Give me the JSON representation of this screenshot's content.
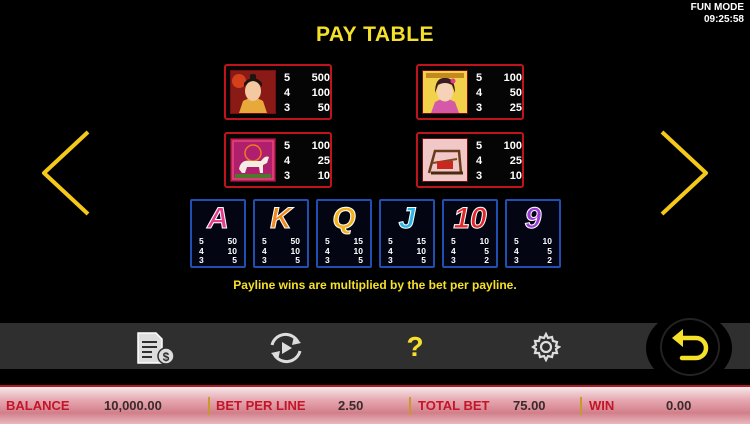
{
  "status": {
    "mode": "FUN MODE",
    "time": "09:25:58"
  },
  "title": "PAY TABLE",
  "symbols_top": [
    {
      "name": "warrior",
      "rows": [
        [
          "5",
          "500"
        ],
        [
          "4",
          "100"
        ],
        [
          "3",
          "50"
        ]
      ]
    },
    {
      "name": "lady",
      "rows": [
        [
          "5",
          "100"
        ],
        [
          "4",
          "50"
        ],
        [
          "3",
          "25"
        ]
      ]
    },
    {
      "name": "horse",
      "rows": [
        [
          "5",
          "100"
        ],
        [
          "4",
          "25"
        ],
        [
          "3",
          "10"
        ]
      ]
    },
    {
      "name": "loom",
      "rows": [
        [
          "5",
          "100"
        ],
        [
          "4",
          "25"
        ],
        [
          "3",
          "10"
        ]
      ]
    }
  ],
  "symbols_low": [
    {
      "letter": "A",
      "color": "#e23c8c",
      "rows": [
        [
          "5",
          "50"
        ],
        [
          "4",
          "10"
        ],
        [
          "3",
          "5"
        ]
      ]
    },
    {
      "letter": "K",
      "color": "#f08a1c",
      "rows": [
        [
          "5",
          "50"
        ],
        [
          "4",
          "10"
        ],
        [
          "3",
          "5"
        ]
      ]
    },
    {
      "letter": "Q",
      "color": "#f2b21b",
      "rows": [
        [
          "5",
          "15"
        ],
        [
          "4",
          "10"
        ],
        [
          "3",
          "5"
        ]
      ]
    },
    {
      "letter": "J",
      "color": "#2bb6e6",
      "rows": [
        [
          "5",
          "15"
        ],
        [
          "4",
          "10"
        ],
        [
          "3",
          "5"
        ]
      ]
    },
    {
      "letter": "10",
      "color": "#e2262a",
      "rows": [
        [
          "5",
          "10"
        ],
        [
          "4",
          "5"
        ],
        [
          "3",
          "2"
        ]
      ]
    },
    {
      "letter": "9",
      "color": "#9c3ad6",
      "rows": [
        [
          "5",
          "10"
        ],
        [
          "4",
          "5"
        ],
        [
          "3",
          "2"
        ]
      ]
    }
  ],
  "note": "Payline wins are multiplied by the bet per payline.",
  "toolbar": {
    "icons": [
      "paytable-icon",
      "autoplay-icon",
      "help-icon",
      "settings-icon"
    ],
    "help_glyph": "?",
    "spin_icon": "return-arrow-icon"
  },
  "footer": {
    "balance_label": "BALANCE",
    "balance_value": "10,000.00",
    "bet_label": "BET PER LINE",
    "bet_value": "2.50",
    "total_label": "TOTAL BET",
    "total_value": "75.00",
    "win_label": "WIN",
    "win_value": "0.00"
  },
  "colors": {
    "accent_yellow": "#f5e02a",
    "frame_red": "#c0141c",
    "frame_blue": "#1f4fb0",
    "label_red": "#c4142a"
  }
}
